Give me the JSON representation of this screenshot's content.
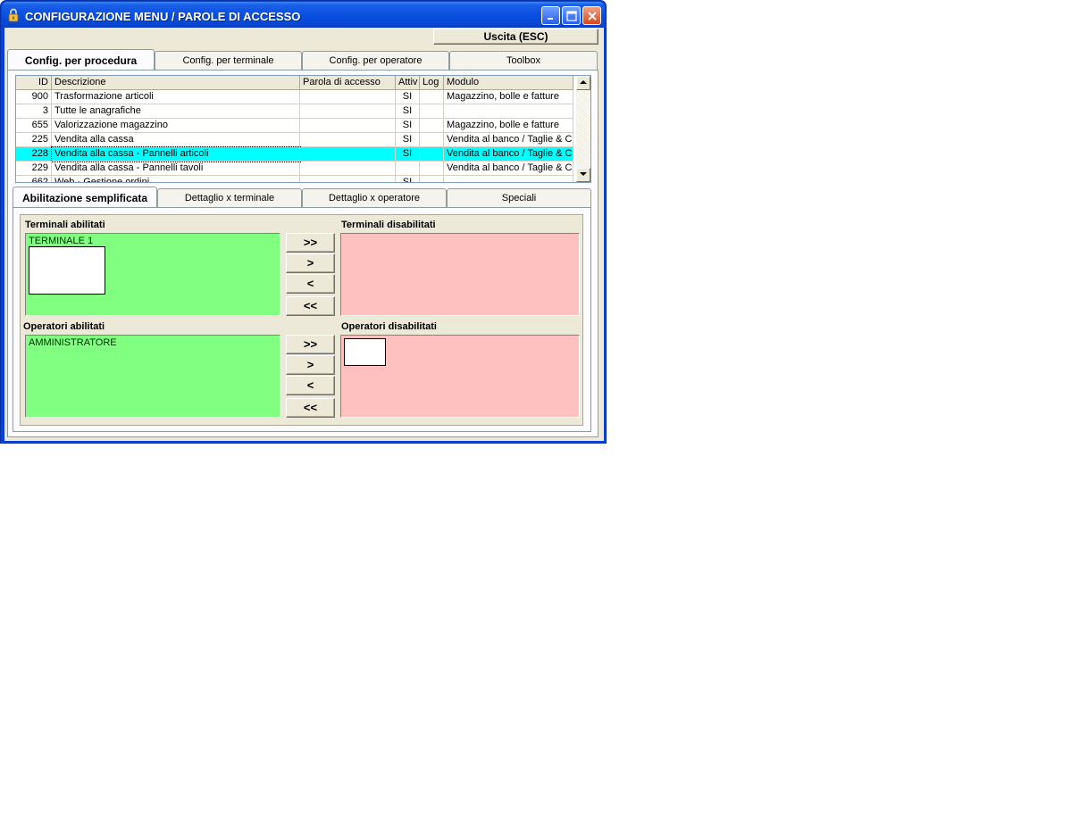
{
  "window": {
    "title": "CONFIGURAZIONE MENU / PAROLE DI ACCESSO"
  },
  "toolbar": {
    "exit_label": "Uscita (ESC)"
  },
  "tabs": [
    {
      "label": "Config. per procedura"
    },
    {
      "label": "Config. per terminale"
    },
    {
      "label": "Config. per operatore"
    },
    {
      "label": "Toolbox"
    }
  ],
  "grid": {
    "columns": [
      "ID",
      "Descrizione",
      "Parola di accesso",
      "Attiv",
      "Log",
      "Modulo"
    ],
    "rows": [
      {
        "id": "900",
        "descr": "Trasformazione articoli",
        "parola": "",
        "attiv": "SI",
        "log": "",
        "modulo": "Magazzino, bolle e fatture"
      },
      {
        "id": "3",
        "descr": "Tutte le anagrafiche",
        "parola": "",
        "attiv": "SI",
        "log": "",
        "modulo": ""
      },
      {
        "id": "655",
        "descr": "Valorizzazione magazzino",
        "parola": "",
        "attiv": "SI",
        "log": "",
        "modulo": "Magazzino, bolle e fatture"
      },
      {
        "id": "225",
        "descr": "Vendita alla cassa",
        "parola": "",
        "attiv": "SI",
        "log": "",
        "modulo": "Vendita al banco / Taglie & C"
      },
      {
        "id": "228",
        "descr": "Vendita alla cassa - Pannelli articoli",
        "parola": "",
        "attiv": "SI",
        "log": "",
        "modulo": "Vendita al banco / Taglie & C"
      },
      {
        "id": "229",
        "descr": "Vendita alla cassa - Pannelli tavoli",
        "parola": "",
        "attiv": "",
        "log": "",
        "modulo": "Vendita al banco / Taglie & C"
      },
      {
        "id": "662",
        "descr": "Web - Gestione ordini",
        "parola": "",
        "attiv": "SI",
        "log": "",
        "modulo": ""
      }
    ],
    "selected_row_index": 4,
    "selection_color": "#00ffff"
  },
  "subtabs": [
    {
      "label": "Abilitazione semplificata"
    },
    {
      "label": "Dettaglio x terminale"
    },
    {
      "label": "Dettaglio x operatore"
    },
    {
      "label": "Speciali"
    }
  ],
  "terminals": {
    "enabled_label": "Terminali abilitati",
    "disabled_label": "Terminali disabilitati",
    "enabled_items": [
      "TERMINALE 1"
    ],
    "disabled_items": []
  },
  "operators": {
    "enabled_label": "Operatori abilitati",
    "disabled_label": "Operatori disabilitati",
    "enabled_items": [
      "AMMINISTRATORE"
    ],
    "disabled_items": []
  },
  "transfer_buttons": {
    "all_right": ">>",
    "one_right": ">",
    "one_left": "<",
    "all_left": "<<"
  },
  "colors": {
    "enabled_list": "#80ff80",
    "disabled_list": "#ffc0c0",
    "titlebar": "#0a50e0"
  },
  "icons": {
    "app": "lock-icon",
    "minimize": "minimize-icon",
    "maximize": "maximize-icon",
    "close": "close-icon",
    "scroll_up": "arrow-up-icon",
    "scroll_down": "arrow-down-icon"
  }
}
